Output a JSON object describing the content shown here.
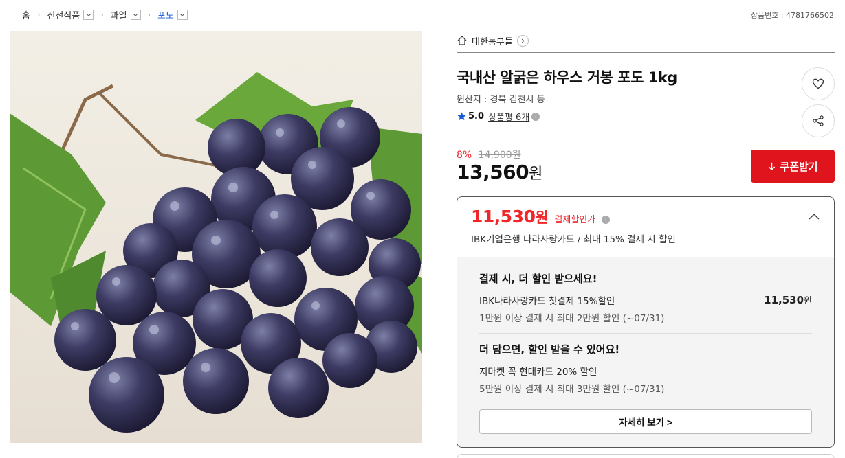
{
  "breadcrumb": {
    "items": [
      {
        "label": "홈"
      },
      {
        "label": "신선식품"
      },
      {
        "label": "과일"
      },
      {
        "label": "포도"
      }
    ]
  },
  "product_no": "상품번호 : 4781766502",
  "seller": {
    "name": "대한농부들"
  },
  "product": {
    "title": "국내산 알굵은 하우스 거봉 포도 1kg",
    "origin": "원산지 : 경북 김천시 등",
    "rating": "5.0",
    "review_label": "상품평 6개"
  },
  "pricing": {
    "discount_rate": "8%",
    "original_price": "14,900원",
    "price_number": "13,560",
    "price_unit": "원",
    "coupon_label": "쿠폰받기"
  },
  "payment": {
    "big_price": "11,530",
    "big_unit": "원",
    "big_label": "결제할인가",
    "card_desc": "IBK기업은행 나라사랑카드 / 최대 15% 결제 시 할인",
    "section1_title": "결제 시, 더 할인 받으세요!",
    "offer1_name": "IBK나라사랑카드 첫결제 15%할인",
    "offer1_amount": "11,530",
    "offer1_unit": "원",
    "offer1_cond": "1만원 이상 결제 시 최대 2만원 할인 (~07/31)",
    "section2_title": "더 담으면, 할인 받을 수 있어요!",
    "offer2_name": "지마켓 꼭 현대카드 20% 할인",
    "offer2_cond": "5만원 이상 결제 시 최대 3만원 할인 (~07/31)",
    "more_label": "자세히 보기 >"
  },
  "colors": {
    "accent_red": "#e0141d",
    "link_blue": "#1a5cd8",
    "star_blue": "#1a5cd8"
  }
}
